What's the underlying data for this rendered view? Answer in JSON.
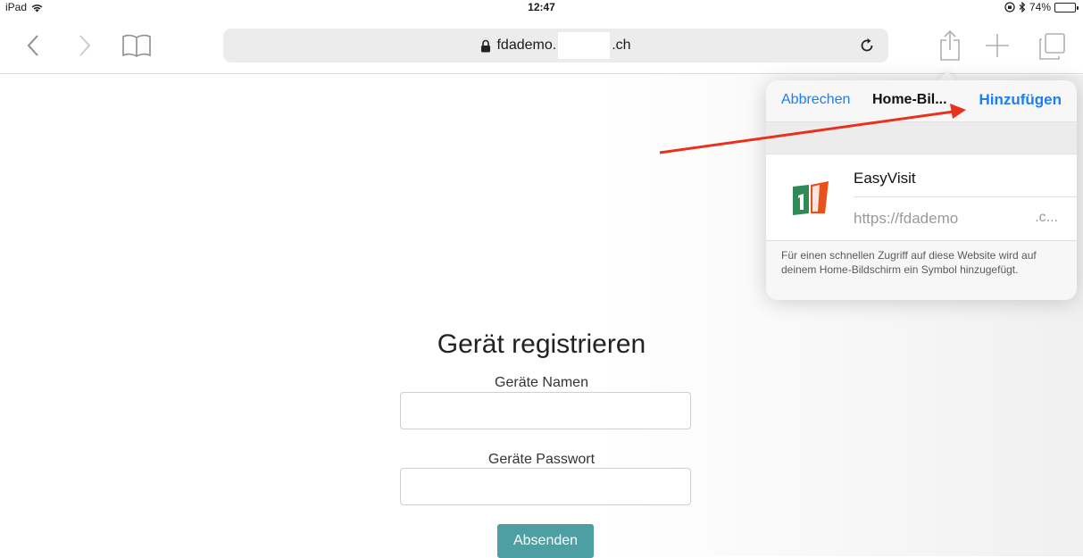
{
  "status_bar": {
    "device": "iPad",
    "time": "12:47",
    "battery": "74%",
    "battery_level": 0.74
  },
  "toolbar": {
    "url_prefix": "fdademo.",
    "url_suffix": ".ch"
  },
  "page": {
    "title": "Gerät registrieren",
    "name_label": "Geräte Namen",
    "password_label": "Geräte Passwort",
    "name_value": "",
    "password_value": "",
    "submit_label": "Absenden"
  },
  "popover": {
    "cancel_label": "Abbrechen",
    "title": "Home-Bil...",
    "add_label": "Hinzufügen",
    "app_name": "EasyVisit",
    "app_url": "https://fdademo",
    "app_url_end": ".c...",
    "description": "Für einen schnellen Zugriff auf diese Website wird auf deinem Home-Bildschirm ein Symbol hinzugefügt."
  },
  "colors": {
    "accent_blue": "#1a7ef5",
    "submit_teal": "#4e9fa3",
    "annotation_red": "#e8321e",
    "icon_green": "#2e8b57",
    "icon_orange": "#e8501c"
  },
  "icons": {
    "back": "chevron-left-icon",
    "forward": "chevron-right-icon",
    "bookmarks": "book-icon",
    "lock": "lock-icon",
    "reload": "reload-icon",
    "share": "share-icon",
    "new_tab": "plus-icon",
    "tabs": "tabs-icon"
  }
}
